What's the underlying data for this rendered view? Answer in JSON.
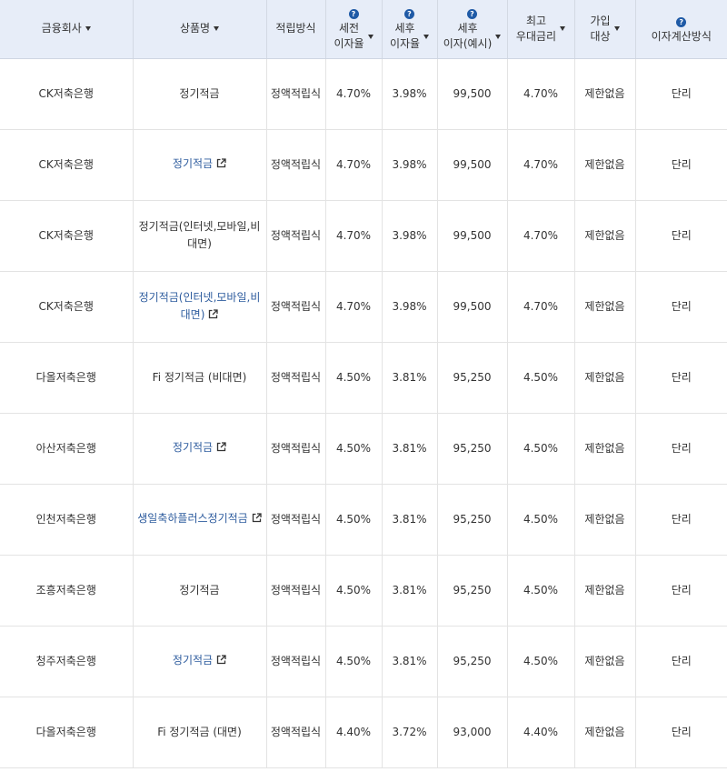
{
  "headers": {
    "company": "금융회사",
    "product": "상품명",
    "method": "적립방식",
    "pre_tax": [
      "세전",
      "이자율"
    ],
    "after_tax": [
      "세후",
      "이자율"
    ],
    "after_tax_interest": [
      "세후",
      "이자(예시)"
    ],
    "max_rate": [
      "최고",
      "우대금리"
    ],
    "join": [
      "가입",
      "대상"
    ],
    "calc": "이자계산방식"
  },
  "help_icon": "?",
  "colors": {
    "header_bg": "#e7edf8",
    "link": "#2e5c9e",
    "help_icon": "#1f5aa6"
  },
  "rows": [
    {
      "company": "CK저축은행",
      "product": "정기적금",
      "link": false,
      "method": "정액적립식",
      "pre": "4.70%",
      "after": "3.98%",
      "interest": "99,500",
      "max": "4.70%",
      "join": "제한없음",
      "calc": "단리"
    },
    {
      "company": "CK저축은행",
      "product": "정기적금",
      "link": true,
      "method": "정액적립식",
      "pre": "4.70%",
      "after": "3.98%",
      "interest": "99,500",
      "max": "4.70%",
      "join": "제한없음",
      "calc": "단리"
    },
    {
      "company": "CK저축은행",
      "product": "정기적금(인터넷,모바일,비대면)",
      "link": false,
      "method": "정액적립식",
      "pre": "4.70%",
      "after": "3.98%",
      "interest": "99,500",
      "max": "4.70%",
      "join": "제한없음",
      "calc": "단리"
    },
    {
      "company": "CK저축은행",
      "product": "정기적금(인터넷,모바일,비대면)",
      "link": true,
      "method": "정액적립식",
      "pre": "4.70%",
      "after": "3.98%",
      "interest": "99,500",
      "max": "4.70%",
      "join": "제한없음",
      "calc": "단리"
    },
    {
      "company": "다올저축은행",
      "product": "Fi 정기적금 (비대면)",
      "link": false,
      "method": "정액적립식",
      "pre": "4.50%",
      "after": "3.81%",
      "interest": "95,250",
      "max": "4.50%",
      "join": "제한없음",
      "calc": "단리"
    },
    {
      "company": "아산저축은행",
      "product": "정기적금",
      "link": true,
      "method": "정액적립식",
      "pre": "4.50%",
      "after": "3.81%",
      "interest": "95,250",
      "max": "4.50%",
      "join": "제한없음",
      "calc": "단리"
    },
    {
      "company": "인천저축은행",
      "product": "생일축하플러스정기적금",
      "link": true,
      "method": "정액적립식",
      "pre": "4.50%",
      "after": "3.81%",
      "interest": "95,250",
      "max": "4.50%",
      "join": "제한없음",
      "calc": "단리"
    },
    {
      "company": "조흥저축은행",
      "product": "정기적금",
      "link": false,
      "method": "정액적립식",
      "pre": "4.50%",
      "after": "3.81%",
      "interest": "95,250",
      "max": "4.50%",
      "join": "제한없음",
      "calc": "단리"
    },
    {
      "company": "청주저축은행",
      "product": "정기적금",
      "link": true,
      "method": "정액적립식",
      "pre": "4.50%",
      "after": "3.81%",
      "interest": "95,250",
      "max": "4.50%",
      "join": "제한없음",
      "calc": "단리"
    },
    {
      "company": "다올저축은행",
      "product": "Fi 정기적금 (대면)",
      "link": false,
      "method": "정액적립식",
      "pre": "4.40%",
      "after": "3.72%",
      "interest": "93,000",
      "max": "4.40%",
      "join": "제한없음",
      "calc": "단리"
    }
  ]
}
